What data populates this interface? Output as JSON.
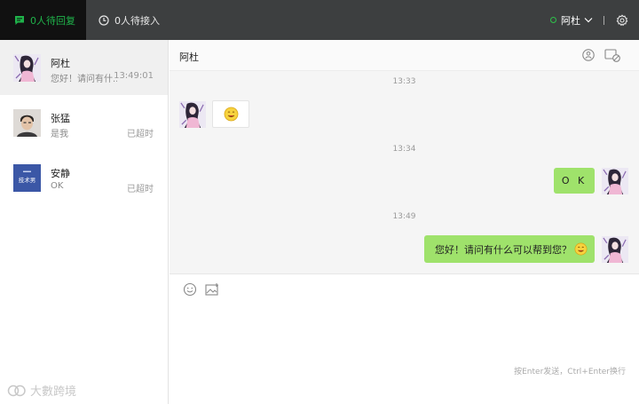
{
  "topbar": {
    "pending_reply": "0人待回复",
    "pending_access": "0人待接入",
    "user_name": "阿杜"
  },
  "sessions": [
    {
      "name": "阿杜",
      "preview": "您好！请问有什...",
      "time": "13:49:01",
      "active": true
    },
    {
      "name": "张猛",
      "preview": "是我",
      "time": "已超时"
    },
    {
      "name": "安静",
      "preview": "OK",
      "time": "已超时"
    }
  ],
  "avatar_text": {
    "session3": "技术男"
  },
  "chat": {
    "title": "阿杜",
    "messages": [
      {
        "time": "13:33",
        "from": "customer",
        "content": "[emoji: smile]"
      },
      {
        "time": "13:34",
        "from": "agent",
        "content": "O K"
      },
      {
        "time": "13:49",
        "from": "agent",
        "content": "您好！请问有什么可以帮到您？"
      }
    ]
  },
  "input": {
    "hint": "按Enter发送，Ctrl+Enter换行"
  },
  "watermark": "大數跨境",
  "colors": {
    "accent": "#1fb34a",
    "bubble": "#9fe26b",
    "topbar": "#3d3f40",
    "online": "#2ec24a"
  }
}
